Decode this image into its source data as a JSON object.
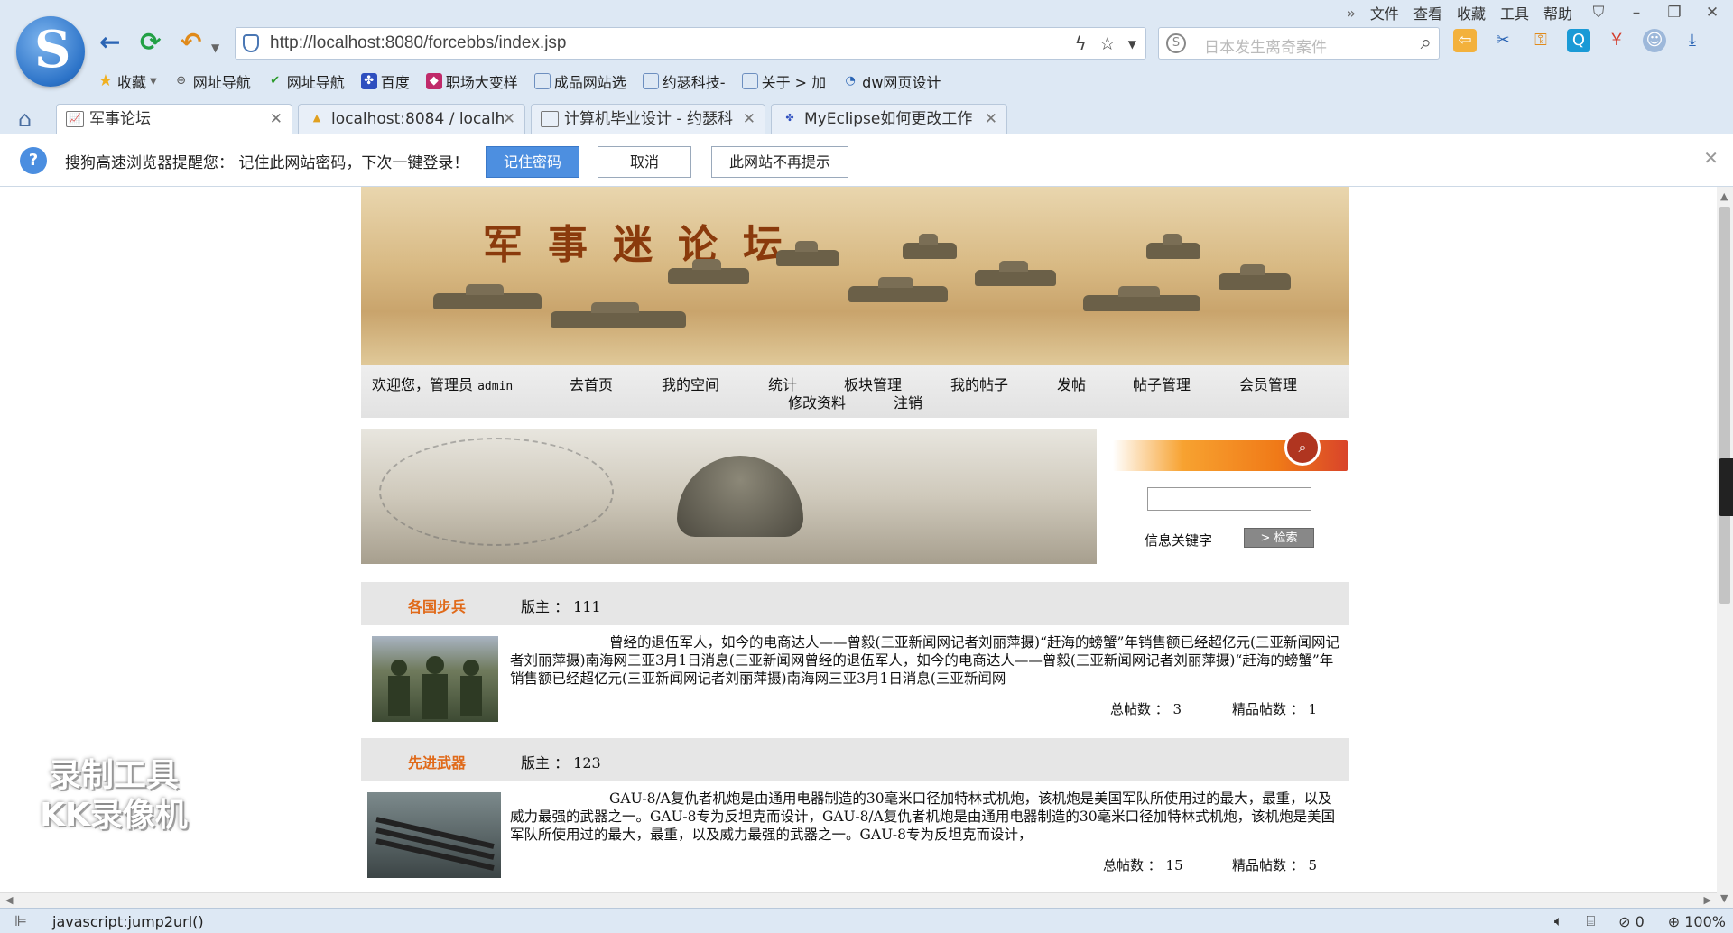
{
  "menu": {
    "items": [
      "文件",
      "查看",
      "收藏",
      "工具",
      "帮助"
    ]
  },
  "address": {
    "url": "http://localhost:8080/forcebbs/index.jsp"
  },
  "search_engine": {
    "placeholder": "日本发生离奇案件"
  },
  "bookmarks": [
    "收藏",
    "网址导航",
    "网址导航",
    "百度",
    "职场大变样",
    "成品网站选",
    "约瑟科技-",
    "关于 > 加",
    "dw网页设计"
  ],
  "tabs": [
    {
      "label": "军事论坛",
      "active": true
    },
    {
      "label": "localhost:8084 / localh",
      "active": false
    },
    {
      "label": "计算机毕业设计 - 约瑟科",
      "active": false
    },
    {
      "label": "MyEclipse如何更改工作",
      "active": false
    }
  ],
  "notify": {
    "message": "搜狗高速浏览器提醒您：  记住此网站密码，下次一键登录！",
    "remember": "记住密码",
    "cancel": "取消",
    "never": "此网站不再提示"
  },
  "site": {
    "title": "军事迷论坛",
    "welcome": "欢迎您，管理员",
    "admin": "admin",
    "nav": [
      "去首页",
      "我的空间",
      "统计",
      "板块管理",
      "我的帖子",
      "发帖",
      "帖子管理",
      "会员管理"
    ],
    "nav2": [
      "修改资料",
      "注销"
    ],
    "search_label": "信息关键字",
    "search_btn": "> 检索"
  },
  "sections": [
    {
      "name": "各国步兵",
      "moderator": "版主 ： 111",
      "desc": "曾经的退伍军人，如今的电商达人——曾毅(三亚新闻网记者刘丽萍摄)“赶海的螃蟹”年销售额已经超亿元(三亚新闻网记者刘丽萍摄)南海网三亚3月1日消息(三亚新闻网曾经的退伍军人，如今的电商达人——曾毅(三亚新闻网记者刘丽萍摄)“赶海的螃蟹”年销售额已经超亿元(三亚新闻网记者刘丽萍摄)南海网三亚3月1日消息(三亚新闻网",
      "total": "总帖数 ： 3",
      "featured": "精品帖数 ： 1"
    },
    {
      "name": "先进武器",
      "moderator": "版主 ： 123",
      "desc": "GAU-8/A复仇者机炮是由通用电器制造的30毫米口径加特林式机炮，该机炮是美国军队所使用过的最大，最重，以及威力最强的武器之一。GAU-8专为反坦克而设计，GAU-8/A复仇者机炮是由通用电器制造的30毫米口径加特林式机炮，该机炮是美国军队所使用过的最大，最重，以及威力最强的武器之一。GAU-8专为反坦克而设计，",
      "total": "总帖数 ： 15",
      "featured": "精品帖数 ： 5"
    }
  ],
  "status": {
    "text": "javascript:jump2url()",
    "count": "0",
    "zoom": "100%"
  },
  "watermark": {
    "line1": "录制工具",
    "line2": "KK录像机"
  }
}
